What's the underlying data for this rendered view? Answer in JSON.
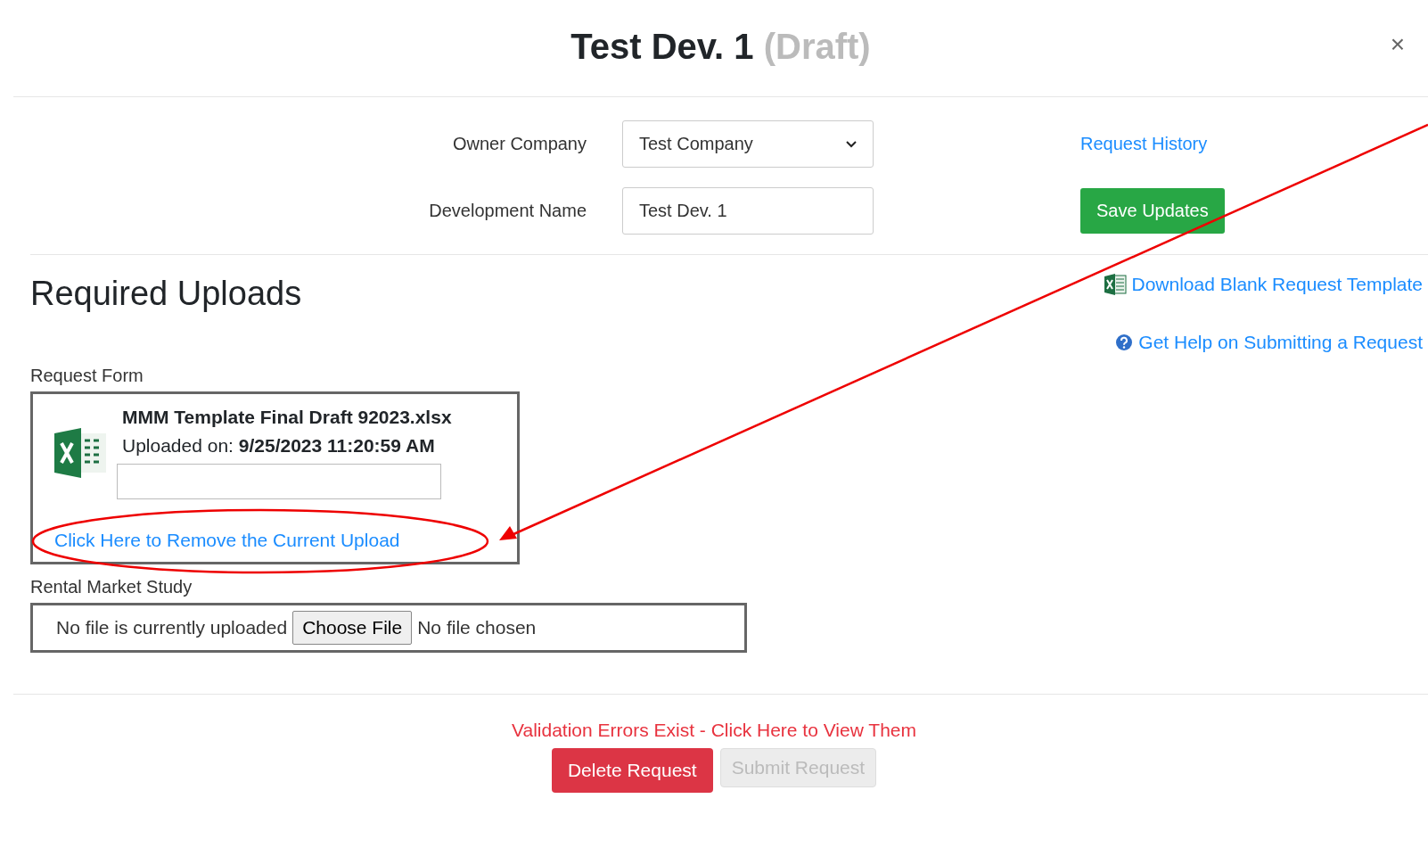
{
  "modal": {
    "title": "Test Dev. 1",
    "status": "(Draft)",
    "close": "×"
  },
  "form": {
    "fields": [
      {
        "kind": "select",
        "label": "Owner Company",
        "value": "Test Company"
      },
      {
        "kind": "text",
        "label": "Development Name",
        "value": "Test Dev. 1"
      }
    ],
    "history_link": "Request History",
    "save_button": "Save Updates"
  },
  "section": {
    "heading": "Required Uploads",
    "links": [
      {
        "kind": "excel",
        "label": "Download Blank Request Template"
      },
      {
        "kind": "help",
        "label": "Get Help on Submitting a Request"
      }
    ]
  },
  "uploads": [
    {
      "kind": "uploaded",
      "label": "Request Form",
      "file_name": "MMM Template Final Draft 92023.xlsx",
      "uploaded_label": "Uploaded on:",
      "uploaded_on": "9/25/2023 11:20:59 AM",
      "remove_link": "Click Here to Remove the Current Upload"
    },
    {
      "kind": "empty",
      "label": "Rental Market Study",
      "status": "No file is currently uploaded",
      "choose_button": "Choose File",
      "chosen_text": "No file chosen"
    }
  ],
  "footer": {
    "validation_message": "Validation Errors Exist - Click Here to View Them",
    "buttons": [
      {
        "kind": "danger",
        "label": "Delete Request",
        "disabled": false
      },
      {
        "kind": "secondary",
        "label": "Submit Request",
        "disabled": true
      }
    ]
  }
}
